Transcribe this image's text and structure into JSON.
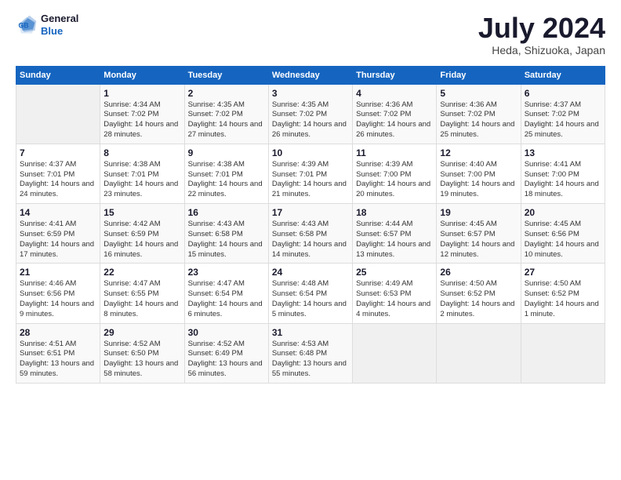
{
  "header": {
    "logo": {
      "general": "General",
      "blue": "Blue"
    },
    "title": "July 2024",
    "location": "Heda, Shizuoka, Japan"
  },
  "days_of_week": [
    "Sunday",
    "Monday",
    "Tuesday",
    "Wednesday",
    "Thursday",
    "Friday",
    "Saturday"
  ],
  "weeks": [
    [
      {
        "day": "",
        "empty": true
      },
      {
        "day": "1",
        "sunrise": "Sunrise: 4:34 AM",
        "sunset": "Sunset: 7:02 PM",
        "daylight": "Daylight: 14 hours and 28 minutes."
      },
      {
        "day": "2",
        "sunrise": "Sunrise: 4:35 AM",
        "sunset": "Sunset: 7:02 PM",
        "daylight": "Daylight: 14 hours and 27 minutes."
      },
      {
        "day": "3",
        "sunrise": "Sunrise: 4:35 AM",
        "sunset": "Sunset: 7:02 PM",
        "daylight": "Daylight: 14 hours and 26 minutes."
      },
      {
        "day": "4",
        "sunrise": "Sunrise: 4:36 AM",
        "sunset": "Sunset: 7:02 PM",
        "daylight": "Daylight: 14 hours and 26 minutes."
      },
      {
        "day": "5",
        "sunrise": "Sunrise: 4:36 AM",
        "sunset": "Sunset: 7:02 PM",
        "daylight": "Daylight: 14 hours and 25 minutes."
      },
      {
        "day": "6",
        "sunrise": "Sunrise: 4:37 AM",
        "sunset": "Sunset: 7:02 PM",
        "daylight": "Daylight: 14 hours and 25 minutes."
      }
    ],
    [
      {
        "day": "7",
        "sunrise": "Sunrise: 4:37 AM",
        "sunset": "Sunset: 7:01 PM",
        "daylight": "Daylight: 14 hours and 24 minutes."
      },
      {
        "day": "8",
        "sunrise": "Sunrise: 4:38 AM",
        "sunset": "Sunset: 7:01 PM",
        "daylight": "Daylight: 14 hours and 23 minutes."
      },
      {
        "day": "9",
        "sunrise": "Sunrise: 4:38 AM",
        "sunset": "Sunset: 7:01 PM",
        "daylight": "Daylight: 14 hours and 22 minutes."
      },
      {
        "day": "10",
        "sunrise": "Sunrise: 4:39 AM",
        "sunset": "Sunset: 7:01 PM",
        "daylight": "Daylight: 14 hours and 21 minutes."
      },
      {
        "day": "11",
        "sunrise": "Sunrise: 4:39 AM",
        "sunset": "Sunset: 7:00 PM",
        "daylight": "Daylight: 14 hours and 20 minutes."
      },
      {
        "day": "12",
        "sunrise": "Sunrise: 4:40 AM",
        "sunset": "Sunset: 7:00 PM",
        "daylight": "Daylight: 14 hours and 19 minutes."
      },
      {
        "day": "13",
        "sunrise": "Sunrise: 4:41 AM",
        "sunset": "Sunset: 7:00 PM",
        "daylight": "Daylight: 14 hours and 18 minutes."
      }
    ],
    [
      {
        "day": "14",
        "sunrise": "Sunrise: 4:41 AM",
        "sunset": "Sunset: 6:59 PM",
        "daylight": "Daylight: 14 hours and 17 minutes."
      },
      {
        "day": "15",
        "sunrise": "Sunrise: 4:42 AM",
        "sunset": "Sunset: 6:59 PM",
        "daylight": "Daylight: 14 hours and 16 minutes."
      },
      {
        "day": "16",
        "sunrise": "Sunrise: 4:43 AM",
        "sunset": "Sunset: 6:58 PM",
        "daylight": "Daylight: 14 hours and 15 minutes."
      },
      {
        "day": "17",
        "sunrise": "Sunrise: 4:43 AM",
        "sunset": "Sunset: 6:58 PM",
        "daylight": "Daylight: 14 hours and 14 minutes."
      },
      {
        "day": "18",
        "sunrise": "Sunrise: 4:44 AM",
        "sunset": "Sunset: 6:57 PM",
        "daylight": "Daylight: 14 hours and 13 minutes."
      },
      {
        "day": "19",
        "sunrise": "Sunrise: 4:45 AM",
        "sunset": "Sunset: 6:57 PM",
        "daylight": "Daylight: 14 hours and 12 minutes."
      },
      {
        "day": "20",
        "sunrise": "Sunrise: 4:45 AM",
        "sunset": "Sunset: 6:56 PM",
        "daylight": "Daylight: 14 hours and 10 minutes."
      }
    ],
    [
      {
        "day": "21",
        "sunrise": "Sunrise: 4:46 AM",
        "sunset": "Sunset: 6:56 PM",
        "daylight": "Daylight: 14 hours and 9 minutes."
      },
      {
        "day": "22",
        "sunrise": "Sunrise: 4:47 AM",
        "sunset": "Sunset: 6:55 PM",
        "daylight": "Daylight: 14 hours and 8 minutes."
      },
      {
        "day": "23",
        "sunrise": "Sunrise: 4:47 AM",
        "sunset": "Sunset: 6:54 PM",
        "daylight": "Daylight: 14 hours and 6 minutes."
      },
      {
        "day": "24",
        "sunrise": "Sunrise: 4:48 AM",
        "sunset": "Sunset: 6:54 PM",
        "daylight": "Daylight: 14 hours and 5 minutes."
      },
      {
        "day": "25",
        "sunrise": "Sunrise: 4:49 AM",
        "sunset": "Sunset: 6:53 PM",
        "daylight": "Daylight: 14 hours and 4 minutes."
      },
      {
        "day": "26",
        "sunrise": "Sunrise: 4:50 AM",
        "sunset": "Sunset: 6:52 PM",
        "daylight": "Daylight: 14 hours and 2 minutes."
      },
      {
        "day": "27",
        "sunrise": "Sunrise: 4:50 AM",
        "sunset": "Sunset: 6:52 PM",
        "daylight": "Daylight: 14 hours and 1 minute."
      }
    ],
    [
      {
        "day": "28",
        "sunrise": "Sunrise: 4:51 AM",
        "sunset": "Sunset: 6:51 PM",
        "daylight": "Daylight: 13 hours and 59 minutes."
      },
      {
        "day": "29",
        "sunrise": "Sunrise: 4:52 AM",
        "sunset": "Sunset: 6:50 PM",
        "daylight": "Daylight: 13 hours and 58 minutes."
      },
      {
        "day": "30",
        "sunrise": "Sunrise: 4:52 AM",
        "sunset": "Sunset: 6:49 PM",
        "daylight": "Daylight: 13 hours and 56 minutes."
      },
      {
        "day": "31",
        "sunrise": "Sunrise: 4:53 AM",
        "sunset": "Sunset: 6:48 PM",
        "daylight": "Daylight: 13 hours and 55 minutes."
      },
      {
        "day": "",
        "empty": true
      },
      {
        "day": "",
        "empty": true
      },
      {
        "day": "",
        "empty": true
      }
    ]
  ]
}
